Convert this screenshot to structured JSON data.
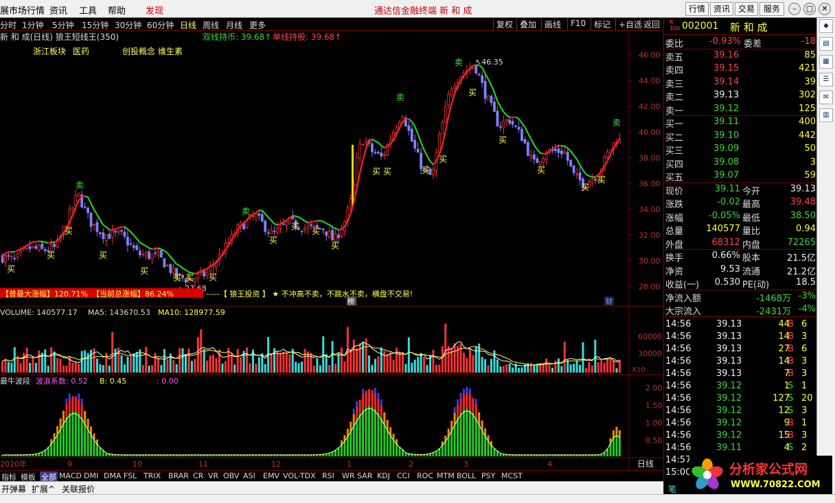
{
  "menu": {
    "items": [
      "展市场行情",
      "资讯",
      "工具",
      "帮助"
    ],
    "discover": "发现",
    "title": "通达信金融终端  新 和 成",
    "right_buttons": [
      "行情",
      "资讯",
      "交易",
      "服务"
    ]
  },
  "toolbar": {
    "periods": [
      "分时",
      "1分钟",
      "5分钟",
      "15分钟",
      "30分钟",
      "60分钟",
      "日线",
      "周线",
      "月线",
      "更多"
    ],
    "active_period": "日线",
    "buttons": [
      "复权",
      "叠加",
      "画线",
      "F10",
      "标记",
      "+自选",
      "返回"
    ]
  },
  "chart": {
    "title": "新 和 成(日线) 狼王短线王(350)",
    "indicator1": "双线持币: 39.68↑",
    "indicator2": "单线持股: 39.68↑",
    "sector": "浙江板块",
    "sector_value": "医药",
    "concept_label": "创投概念",
    "concept_value": "维生素",
    "high_label": "46.35",
    "low_label": "27.68",
    "price_ticks": [
      "46.00",
      "44.00",
      "42.00",
      "40.00",
      "38.00",
      "36.00",
      "34.00",
      "32.00",
      "30.00",
      "28.00"
    ],
    "banner_max": "【曾最大涨幅】120.71%",
    "banner_cur": "【当前总涨幅】86.24%",
    "banner_slogan": "-----【 狼王投资 】 ★ 不冲高不卖，不跳水不卖，横盘不交易!",
    "bang": "榜",
    "cai": "财",
    "buy": "买",
    "sell": "卖"
  },
  "volume": {
    "label": "VOLUME: 140577.17",
    "ma5": "MA5: 143670.53",
    "ma10": "MA10: 128977.59",
    "ticks": [
      "60000",
      "30000"
    ],
    "unit": "X10"
  },
  "wave": {
    "title": "最牛波段",
    "coef": "波浪系数: 0.52",
    "b": "B: 0.45",
    "c": ": 0.00",
    "ticks": [
      "2.00",
      "1.50",
      "1.00",
      "0.50"
    ]
  },
  "xaxis": {
    "labels": [
      "2020年",
      "9",
      "10",
      "11",
      "12",
      "1",
      "2",
      "3",
      "4"
    ],
    "period": "日线"
  },
  "tabs": [
    "指标",
    "模板",
    "全部",
    "MACD",
    "DMI",
    "DMA",
    "FSL",
    "TRIX",
    "BRAR",
    "CR",
    "VR",
    "OBV",
    "ASI",
    "EMV",
    "VOL-TDX",
    "RSI",
    "WR",
    "SAR",
    "KDJ",
    "CCI",
    "ROC",
    "MTM",
    "BOLL",
    "PSY",
    "MCST"
  ],
  "status_items": [
    "开弹幕",
    "扩展^",
    "关联报价"
  ],
  "quote": {
    "code": "002001",
    "name": "新 和 成",
    "wb_label": "委比",
    "wb": "-0.93%",
    "wc_label": "委差",
    "wc": "-18",
    "asks": [
      {
        "l": "卖五",
        "p": "39.16",
        "v": "85"
      },
      {
        "l": "卖四",
        "p": "39.15",
        "v": "421"
      },
      {
        "l": "卖三",
        "p": "39.14",
        "v": "39"
      },
      {
        "l": "卖二",
        "p": "39.13",
        "v": "302"
      },
      {
        "l": "卖一",
        "p": "39.12",
        "v": "125"
      }
    ],
    "bids": [
      {
        "l": "买一",
        "p": "39.11",
        "v": "400"
      },
      {
        "l": "买二",
        "p": "39.10",
        "v": "442"
      },
      {
        "l": "买三",
        "p": "39.09",
        "v": "50"
      },
      {
        "l": "买四",
        "p": "39.08",
        "v": "3"
      },
      {
        "l": "买五",
        "p": "39.07",
        "v": "59"
      }
    ],
    "stats": [
      {
        "a": "现价",
        "av": "39.11",
        "b": "今开",
        "bv": "39.13"
      },
      {
        "a": "涨跌",
        "av": "-0.02",
        "b": "最高",
        "bv": "39.48"
      },
      {
        "a": "涨幅",
        "av": "-0.05%",
        "b": "最低",
        "bv": "38.50"
      },
      {
        "a": "总量",
        "av": "140577",
        "b": "量比",
        "bv": "0.94"
      },
      {
        "a": "外盘",
        "av": "68312",
        "b": "内盘",
        "bv": "72265"
      }
    ],
    "stats2": [
      {
        "a": "换手",
        "av": "0.66%",
        "b": "股本",
        "bv": "21.5亿"
      },
      {
        "a": "净资",
        "av": "9.53",
        "b": "流通",
        "bv": "21.2亿"
      },
      {
        "a": "收益(一)",
        "av": "0.530",
        "b": "PE(动)",
        "bv": "18.5"
      }
    ],
    "flow": [
      {
        "l": "净流入额",
        "v": "-1468万",
        "p": "-3%"
      },
      {
        "l": "大宗流入",
        "v": "-2431万",
        "p": "-4%"
      }
    ],
    "ticks": [
      {
        "t": "14:56",
        "p": "39.13",
        "v": "44",
        "s": "B",
        "x": "6"
      },
      {
        "t": "14:56",
        "p": "39.13",
        "v": "14",
        "s": "B",
        "x": "3"
      },
      {
        "t": "14:56",
        "p": "39.13",
        "v": "27",
        "s": "B",
        "x": "6"
      },
      {
        "t": "14:56",
        "p": "39.13",
        "v": "14",
        "s": "B",
        "x": "3"
      },
      {
        "t": "14:56",
        "p": "39.13",
        "v": "7",
        "s": "B",
        "x": "3"
      },
      {
        "t": "14:56",
        "p": "39.12",
        "v": "1",
        "s": "S",
        "x": "1"
      },
      {
        "t": "14:56",
        "p": "39.12",
        "v": "127",
        "s": "S",
        "x": "20"
      },
      {
        "t": "14:56",
        "p": "39.12",
        "v": "12",
        "s": "S",
        "x": "3"
      },
      {
        "t": "14:56",
        "p": "39.12",
        "v": "9",
        "s": "B",
        "x": "1"
      },
      {
        "t": "14:56",
        "p": "39.12",
        "v": "15",
        "s": "B",
        "x": "3"
      },
      {
        "t": "14:56",
        "p": "39.11",
        "v": "4",
        "s": "S",
        "x": "2"
      },
      {
        "t": "14:57",
        "p": "",
        "v": "",
        "s": "",
        "x": ""
      },
      {
        "t": "15:00",
        "p": "",
        "v": "",
        "s": "",
        "x": ""
      }
    ],
    "bi": "笔"
  },
  "logo": {
    "text": "分析家公式网",
    "url": "WWW.70822.COM"
  },
  "colors": {
    "up": "#ff3333",
    "down": "#8080ff",
    "ma_red": "#ff2020",
    "ma_green": "#20d020",
    "bg": "#000000",
    "grid": "#800000"
  }
}
